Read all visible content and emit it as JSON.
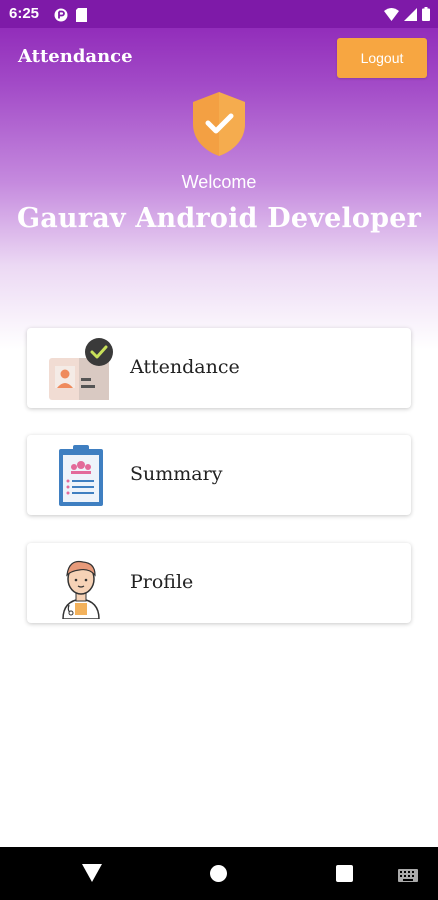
{
  "status_bar": {
    "time": "6:25",
    "icons": [
      "data-saver-icon",
      "sim-card-icon",
      "wifi-icon",
      "signal-icon",
      "battery-icon"
    ]
  },
  "header": {
    "title": "Attendance",
    "logout_label": "Logout",
    "welcome": "Welcome",
    "user_name": "Gaurav Android Developer",
    "icon": "shield-check-icon"
  },
  "menu": [
    {
      "label": "Attendance",
      "icon": "id-card-check-icon"
    },
    {
      "label": "Summary",
      "icon": "clipboard-icon"
    },
    {
      "label": "Profile",
      "icon": "doctor-avatar-icon"
    }
  ],
  "navigation": {
    "icons": [
      "back-icon",
      "home-icon",
      "recents-icon",
      "keyboard-icon"
    ]
  },
  "colors": {
    "primary": "#8a1fb4",
    "accent": "#f7a641",
    "status_bar": "#7e1aa8"
  }
}
